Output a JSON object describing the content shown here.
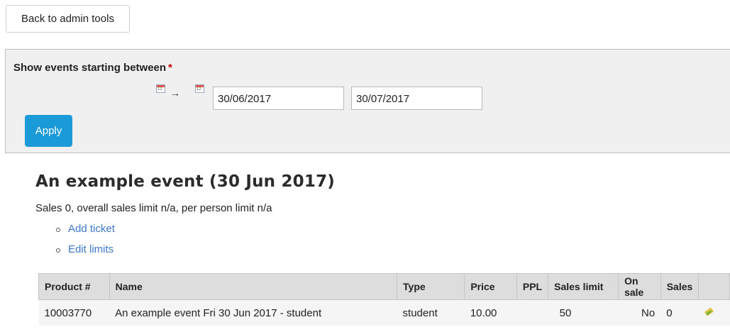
{
  "toolbar": {
    "back_label": "Back to admin tools"
  },
  "filter": {
    "label": "Show events starting between",
    "required_marker": "*",
    "arrow": "→",
    "start_date": "30/06/2017",
    "end_date": "30/07/2017",
    "apply_label": "Apply",
    "calendar_icon": "calendar-icon"
  },
  "event": {
    "title": "An example event (30 Jun 2017)",
    "sales_summary": "Sales 0, overall sales limit n/a, per person limit n/a",
    "links": [
      "Add ticket",
      "Edit limits"
    ]
  },
  "table": {
    "headers": [
      "Product #",
      "Name",
      "Type",
      "Price",
      "PPL",
      "Sales limit",
      "On sale",
      "Sales",
      ""
    ],
    "rows": [
      {
        "product": "10003770",
        "name": "An example event Fri 30 Jun 2017 - student",
        "type": "student",
        "price": "10.00",
        "ppl": "",
        "sales_limit": "50",
        "on_sale": "No",
        "sales": "0",
        "action_icon": "edit-icon"
      }
    ]
  },
  "colors": {
    "accent": "#1a9ad6",
    "link": "#3d78c8",
    "required": "#cc0000"
  }
}
